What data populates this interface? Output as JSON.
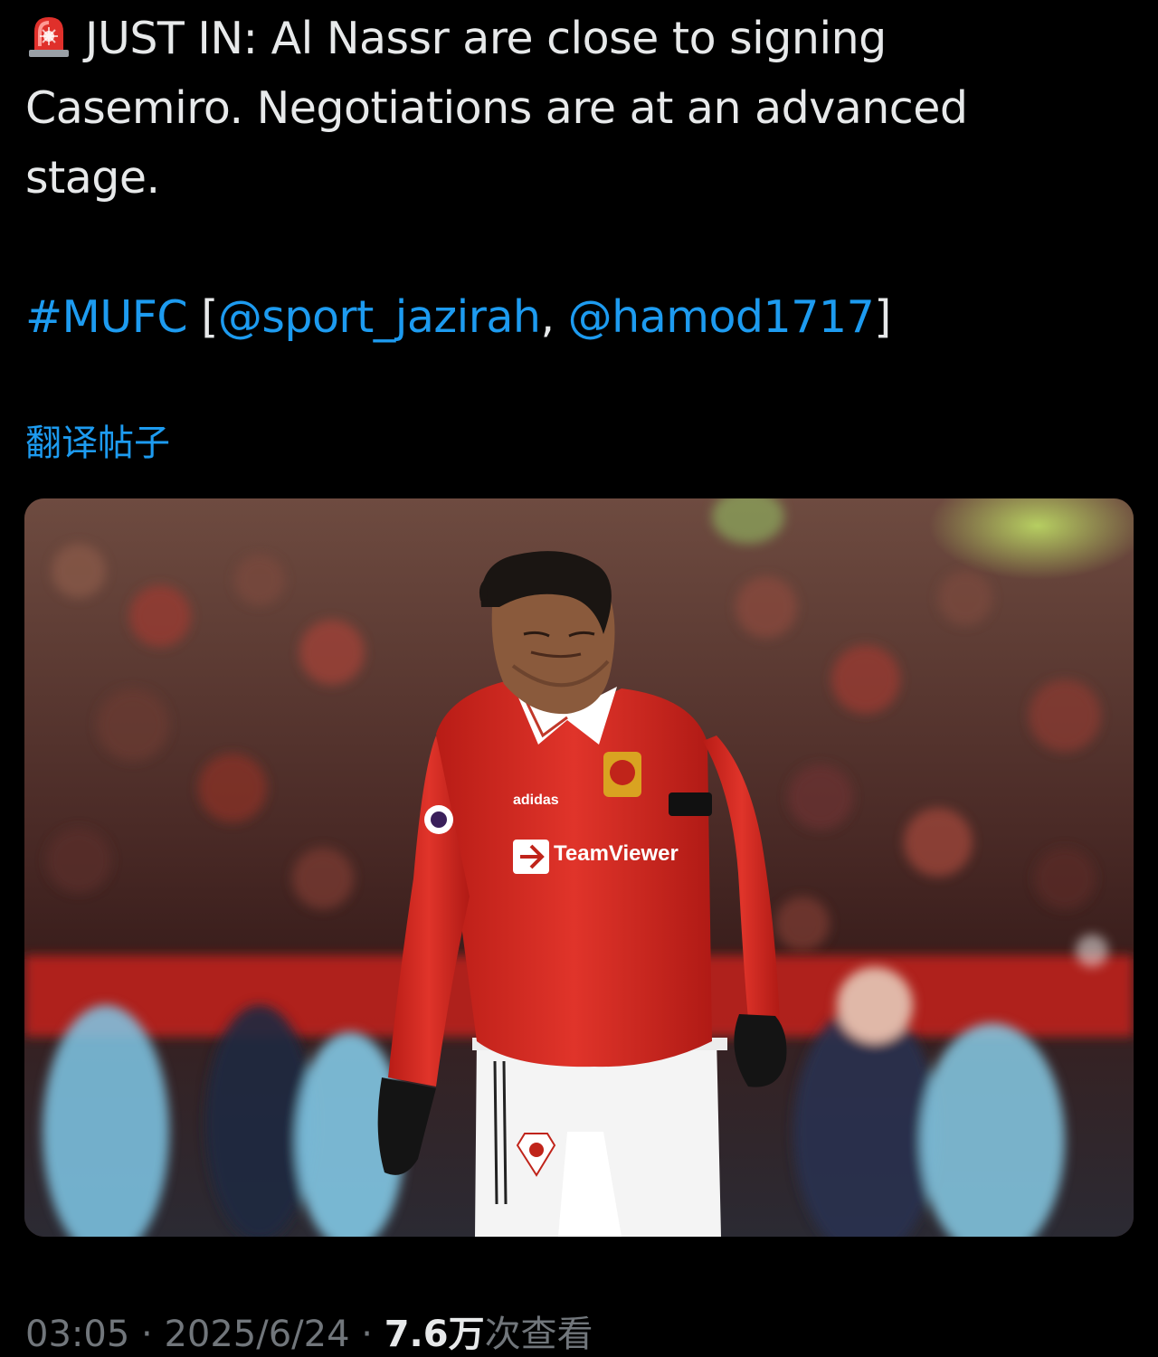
{
  "tweet": {
    "line1_text": "JUST IN: Al Nassr are close to signing",
    "line2_text": "Casemiro. Negotiations are at an advanced",
    "line3_text": "stage.",
    "hashtag": "#MUFC",
    "bracket_open": "[",
    "mention1": "@sport_jazirah",
    "separator": ", ",
    "mention2": "@hamod1717",
    "bracket_close": "]",
    "siren_icon": "police-car-light-emoji"
  },
  "translate_label": "翻译帖子",
  "media": {
    "jersey_sponsor": "TeamViewer",
    "kit_brand": "adidas"
  },
  "meta": {
    "time": "03:05",
    "dot": "·",
    "date": "2025/6/24",
    "dot2": "·",
    "views_count": "7.6万",
    "views_label": "次查看"
  },
  "colors": {
    "background": "#000000",
    "text": "#e7e9ea",
    "link": "#1d9bf0",
    "muted": "#71767b",
    "jersey": "#d2261c"
  }
}
